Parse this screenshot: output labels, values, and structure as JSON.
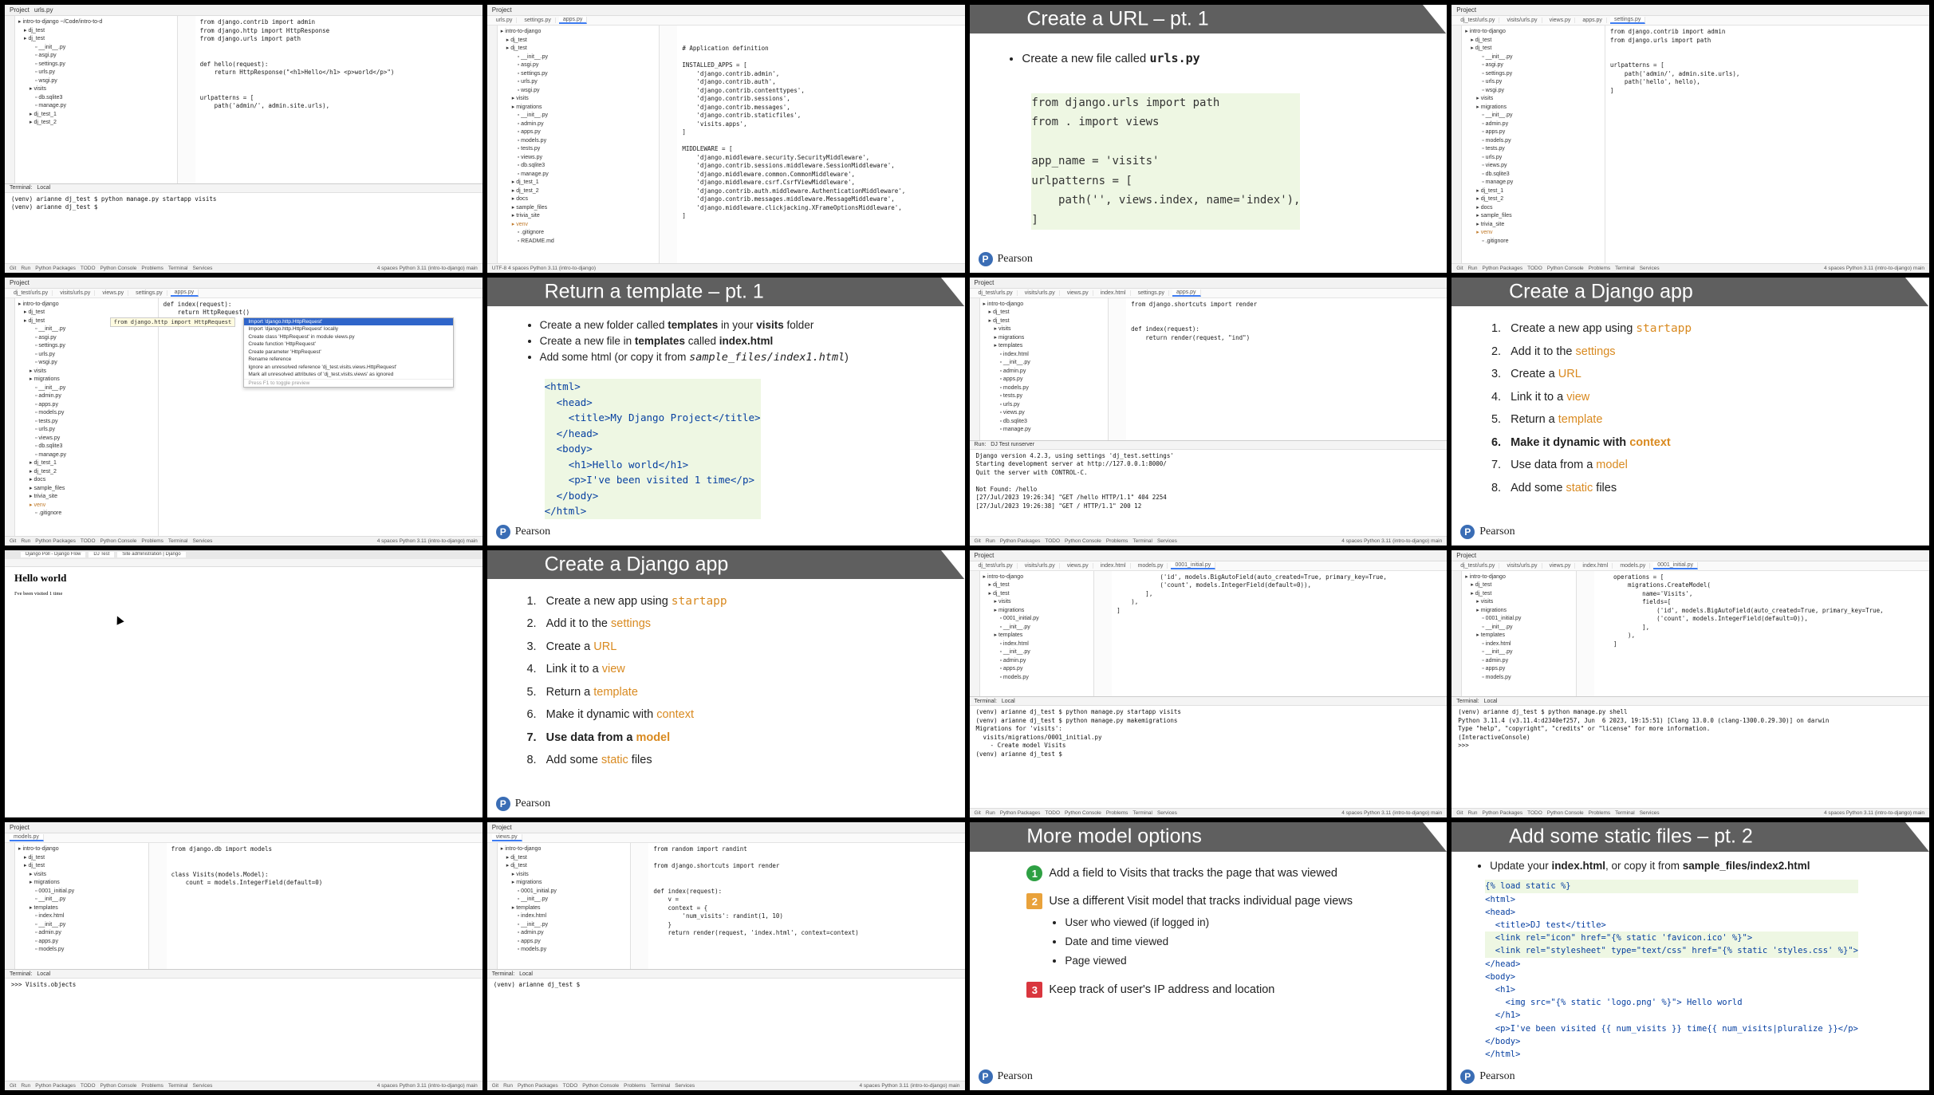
{
  "tiles": {
    "t1": {
      "project": "Project",
      "branch": "intro-to-django",
      "tab": "urls.py",
      "tree": [
        "intro-to-django  ~/Code/intro-to-d",
        "dj_test",
        "dj_test",
        "__init__.py",
        "asgi.py",
        "settings.py",
        "urls.py",
        "wsgi.py",
        "visits",
        "db.sqlite3",
        "manage.py",
        "dj_test_1",
        "dj_test_2"
      ],
      "code": [
        "from django.contrib import admin",
        "from django.http import HttpResponse",
        "from django.urls import path",
        "",
        "",
        "def hello(request):",
        "    return HttpResponse(\"<h1>Hello</h1> <p>world</p>\")",
        "",
        "",
        "urlpatterns = [",
        "    path('admin/', admin.site.urls),"
      ],
      "term_tabs": [
        "Terminal:",
        "Local"
      ],
      "term": [
        "(venv) arianne dj_test $ python manage.py startapp visits",
        "(venv) arianne dj_test $"
      ],
      "status": [
        "Git",
        "Run",
        "Python Packages",
        "TODO",
        "Python Console",
        "Problems",
        "Terminal",
        "Services"
      ],
      "status_right": "4 spaces  Python 3.11 (intro-to-django)  main"
    },
    "t2": {
      "tabs": [
        "urls.py",
        "settings.py",
        "apps.py"
      ],
      "tree": [
        "intro-to-django",
        "dj_test",
        "dj_test",
        "__init__.py",
        "asgi.py",
        "settings.py",
        "urls.py",
        "wsgi.py",
        "visits",
        "migrations",
        "__init__.py",
        "admin.py",
        "apps.py",
        "models.py",
        "tests.py",
        "views.py",
        "db.sqlite3",
        "manage.py",
        "dj_test_1",
        "dj_test_2",
        "docs",
        "sample_files",
        "trivia_site",
        "venv",
        ".gitignore",
        "README.md"
      ],
      "code": [
        "",
        "",
        "# Application definition",
        "",
        "INSTALLED_APPS = [",
        "    'django.contrib.admin',",
        "    'django.contrib.auth',",
        "    'django.contrib.contenttypes',",
        "    'django.contrib.sessions',",
        "    'django.contrib.messages',",
        "    'django.contrib.staticfiles',",
        "    'visits.apps',",
        "]",
        "",
        "MIDDLEWARE = [",
        "    'django.middleware.security.SecurityMiddleware',",
        "    'django.contrib.sessions.middleware.SessionMiddleware',",
        "    'django.middleware.common.CommonMiddleware',",
        "    'django.middleware.csrf.CsrfViewMiddleware',",
        "    'django.contrib.auth.middleware.AuthenticationMiddleware',",
        "    'django.contrib.messages.middleware.MessageMiddleware',",
        "    'django.middleware.clickjacking.XFrameOptionsMiddleware',",
        "]"
      ],
      "status_right": "UTF-8  4 spaces  Python 3.11 (intro-to-django)"
    },
    "t3": {
      "title": "Create a URL – pt. 1",
      "bullet_pre": "Create a new file called ",
      "bullet_file": "urls.py",
      "code": [
        "from django.urls import path",
        "from . import views",
        "",
        "app_name = 'visits'",
        "urlpatterns = [",
        "    path('', views.index, name='index'),",
        "]"
      ],
      "brand": "Pearson"
    },
    "t4": {
      "tabs": [
        "dj_test/urls.py",
        "visits/urls.py",
        "views.py",
        "apps.py",
        "settings.py"
      ],
      "tree": [
        "intro-to-django",
        "dj_test",
        "dj_test",
        "__init__.py",
        "asgi.py",
        "settings.py",
        "urls.py",
        "wsgi.py",
        "visits",
        "migrations",
        "__init__.py",
        "admin.py",
        "apps.py",
        "models.py",
        "tests.py",
        "urls.py",
        "views.py",
        "db.sqlite3",
        "manage.py",
        "dj_test_1",
        "dj_test_2",
        "docs",
        "sample_files",
        "trivia_site",
        "venv",
        ".gitignore"
      ],
      "code": [
        "from django.contrib import admin",
        "from django.urls import path",
        "",
        "",
        "urlpatterns = [",
        "    path('admin/', admin.site.urls),",
        "    path('hello', hello),",
        "]"
      ]
    },
    "t5": {
      "tabs": [
        "dj_test/urls.py",
        "visits/urls.py",
        "views.py",
        "settings.py",
        "apps.py"
      ],
      "tree": [
        "intro-to-django",
        "dj_test",
        "dj_test",
        "__init__.py",
        "asgi.py",
        "settings.py",
        "urls.py",
        "wsgi.py",
        "visits",
        "migrations",
        "__init__.py",
        "admin.py",
        "apps.py",
        "models.py",
        "tests.py",
        "urls.py",
        "views.py",
        "db.sqlite3",
        "manage.py",
        "dj_test_1",
        "dj_test_2",
        "docs",
        "sample_files",
        "trivia_site",
        "venv",
        ".gitignore"
      ],
      "code": [
        "def index(request):",
        "    return HttpRequest()"
      ],
      "popup_hint": "from django.http import HttpRequest",
      "menu": [
        "Import 'django.http.HttpRequest'",
        "Import 'django.http.HttpRequest' locally",
        "Create class 'HttpRequest' in module views.py",
        "Create function 'HttpRequest'",
        "Create parameter 'HttpRequest'",
        "Rename reference",
        "Ignore an unresolved reference 'dj_test.visits.views.HttpRequest'",
        "Mark all unresolved attributes of 'dj_test.visits.views' as ignored"
      ],
      "menu_foot": "Press F1 to toggle preview"
    },
    "t6": {
      "title": "Return a template – pt. 1",
      "bullets": [
        [
          "Create a new folder called ",
          "templates",
          " in your ",
          "visits",
          " folder"
        ],
        [
          "Create a new file in ",
          "templates",
          " called ",
          "index.html",
          ""
        ],
        [
          "Add some html (or copy it from ",
          "sample_files/index1.html",
          ")",
          "",
          ""
        ]
      ],
      "code": [
        "<html>",
        "  <head>",
        "    <title>My Django Project</title>",
        "  </head>",
        "  <body>",
        "    <h1>Hello world</h1>",
        "    <p>I've been visited 1 time</p>",
        "  </body>",
        "</html>"
      ],
      "brand": "Pearson"
    },
    "t7": {
      "tabs": [
        "dj_test/urls.py",
        "visits/urls.py",
        "views.py",
        "index.html",
        "settings.py",
        "apps.py"
      ],
      "tree": [
        "intro-to-django",
        "dj_test",
        "dj_test",
        "visits",
        "migrations",
        "templates",
        "index.html",
        "__init__.py",
        "admin.py",
        "apps.py",
        "models.py",
        "tests.py",
        "urls.py",
        "views.py",
        "db.sqlite3",
        "manage.py"
      ],
      "code": [
        "from django.shortcuts import render",
        "",
        "",
        "def index(request):",
        "    return render(request, \"ind\")"
      ],
      "run_label": "Run:",
      "run_tab": "DJ Test runserver",
      "run": [
        "Django version 4.2.3, using settings 'dj_test.settings'",
        "Starting development server at http://127.0.0.1:8000/",
        "Quit the server with CONTROL-C.",
        "",
        "Not Found: /hello",
        "[27/Jul/2023 19:26:34] \"GET /hello HTTP/1.1\" 404 2254",
        "[27/Jul/2023 19:26:38] \"GET / HTTP/1.1\" 200 12"
      ]
    },
    "t8": {
      "title": "Create a Django app",
      "brand": "Pearson",
      "steps": [
        [
          "Create a new app using ",
          "startapp"
        ],
        [
          "Add it to the ",
          "settings"
        ],
        [
          "Create a ",
          "URL"
        ],
        [
          "Link it to a ",
          "view"
        ],
        [
          "Return a ",
          "template"
        ],
        [
          "Make it dynamic with ",
          "context"
        ],
        [
          "Use data from a ",
          "model"
        ],
        [
          "Add some ",
          "static",
          " files"
        ]
      ]
    },
    "t9": {
      "heading": "Hello world",
      "para": "I've been visited 1 time",
      "tabs": [
        "Django Poll - Django Flow",
        "DJ Test",
        "Site administration | Django"
      ]
    },
    "t10": {
      "title": "Create a Django app",
      "brand": "Pearson",
      "steps": [
        [
          "Create a new app using ",
          "startapp"
        ],
        [
          "Add it to the ",
          "settings"
        ],
        [
          "Create a ",
          "URL"
        ],
        [
          "Link it to a ",
          "view"
        ],
        [
          "Return a ",
          "template"
        ],
        [
          "Make it dynamic with ",
          "context"
        ],
        [
          "Use data from a ",
          "model"
        ],
        [
          "Add some ",
          "static",
          " files"
        ]
      ]
    },
    "t11": {
      "tabs": [
        "dj_test/urls.py",
        "visits/urls.py",
        "views.py",
        "index.html",
        "models.py",
        "0001_initial.py"
      ],
      "tree": [
        "intro-to-django",
        "dj_test",
        "dj_test",
        "visits",
        "migrations",
        "0001_initial.py",
        "__init__.py",
        "templates",
        "index.html",
        "__init__.py",
        "admin.py",
        "apps.py",
        "models.py"
      ],
      "code": [
        "            ('id', models.BigAutoField(auto_created=True, primary_key=True,",
        "            ('count', models.IntegerField(default=0)),",
        "        ],",
        "    ),",
        "]"
      ],
      "term": [
        "(venv) arianne dj_test $ python manage.py startapp visits",
        "(venv) arianne dj_test $ python manage.py makemigrations",
        "Migrations for 'visits':",
        "  visits/migrations/0001_initial.py",
        "    - Create model Visits",
        "(venv) arianne dj_test $"
      ]
    },
    "t12": {
      "tabs": [
        "dj_test/urls.py",
        "visits/urls.py",
        "views.py",
        "index.html",
        "models.py",
        "0001_initial.py"
      ],
      "tree": [
        "intro-to-django",
        "dj_test",
        "dj_test",
        "visits",
        "migrations",
        "0001_initial.py",
        "__init__.py",
        "templates",
        "index.html",
        "__init__.py",
        "admin.py",
        "apps.py",
        "models.py"
      ],
      "code": [
        "    operations = [",
        "        migrations.CreateModel(",
        "            name='Visits',",
        "            fields=[",
        "                ('id', models.BigAutoField(auto_created=True, primary_key=True,",
        "                ('count', models.IntegerField(default=0)),",
        "            ],",
        "        ),",
        "    ]"
      ],
      "term": [
        "(venv) arianne dj_test $ python manage.py shell",
        "Python 3.11.4 (v3.11.4:d2340ef257, Jun  6 2023, 19:15:51) [Clang 13.0.0 (clang-1300.0.29.30)] on darwin",
        "Type \"help\", \"copyright\", \"credits\" or \"license\" for more information.",
        "(InteractiveConsole)",
        ">>>"
      ]
    },
    "t13": {
      "tabs": [
        "models.py"
      ],
      "tree": [
        "intro-to-django",
        "dj_test",
        "dj_test",
        "visits",
        "migrations",
        "0001_initial.py",
        "__init__.py",
        "templates",
        "index.html",
        "__init__.py",
        "admin.py",
        "apps.py",
        "models.py"
      ],
      "code": [
        "from django.db import models",
        "",
        "",
        "class Visits(models.Model):",
        "    count = models.IntegerField(default=0)"
      ],
      "term": [
        ">>> Visits.objects"
      ]
    },
    "t14": {
      "tabs": [
        "views.py"
      ],
      "tree": [
        "intro-to-django",
        "dj_test",
        "dj_test",
        "visits",
        "migrations",
        "0001_initial.py",
        "__init__.py",
        "templates",
        "index.html",
        "__init__.py",
        "admin.py",
        "apps.py",
        "models.py"
      ],
      "code": [
        "from random import randint",
        "",
        "from django.shortcuts import render",
        "",
        "",
        "def index(request):",
        "    v = ",
        "    context = {",
        "        'num_visits': randint(1, 10)",
        "    }",
        "    return render(request, 'index.html', context=context)"
      ],
      "term": [
        "(venv) arianne dj_test $"
      ]
    },
    "t15": {
      "title": "More model options",
      "brand": "Pearson",
      "items": [
        {
          "n": "1",
          "text": "Add a field to Visits that tracks the page that was viewed",
          "color": "#2ea043"
        },
        {
          "n": "2",
          "text": "Use a different Visit model that tracks individual page views",
          "color": "#e9a23b"
        },
        {
          "n": "3",
          "text": "Keep track of user's IP address and location",
          "color": "#d9363e"
        }
      ],
      "sub": [
        "User who viewed (if logged in)",
        "Date and time viewed",
        "Page viewed"
      ]
    },
    "t16": {
      "title": "Add some static files – pt. 2",
      "brand": "Pearson",
      "bullet_pre": "Update your ",
      "bullet_file": "index.html",
      ", or copy it from ": "",
      "bullet_mid": ", or copy it from ",
      "bullet_file2": "sample_files/index2.html",
      "code": [
        "{% load static %}",
        "<html>",
        "<head>",
        "  <title>DJ test</title>",
        "  <link rel=\"icon\" href=\"{% static 'favicon.ico' %}\">",
        "  <link rel=\"stylesheet\" type=\"text/css\" href=\"{% static 'styles.css' %}\">",
        "</head>",
        "<body>",
        "  <h1>",
        "    <img src=\"{% static 'logo.png' %}\"> Hello world",
        "  </h1>",
        "  <p>I've been visited {{ num_visits }} time{{ num_visits|pluralize }}</p>",
        "</body>",
        "</html>"
      ]
    }
  }
}
